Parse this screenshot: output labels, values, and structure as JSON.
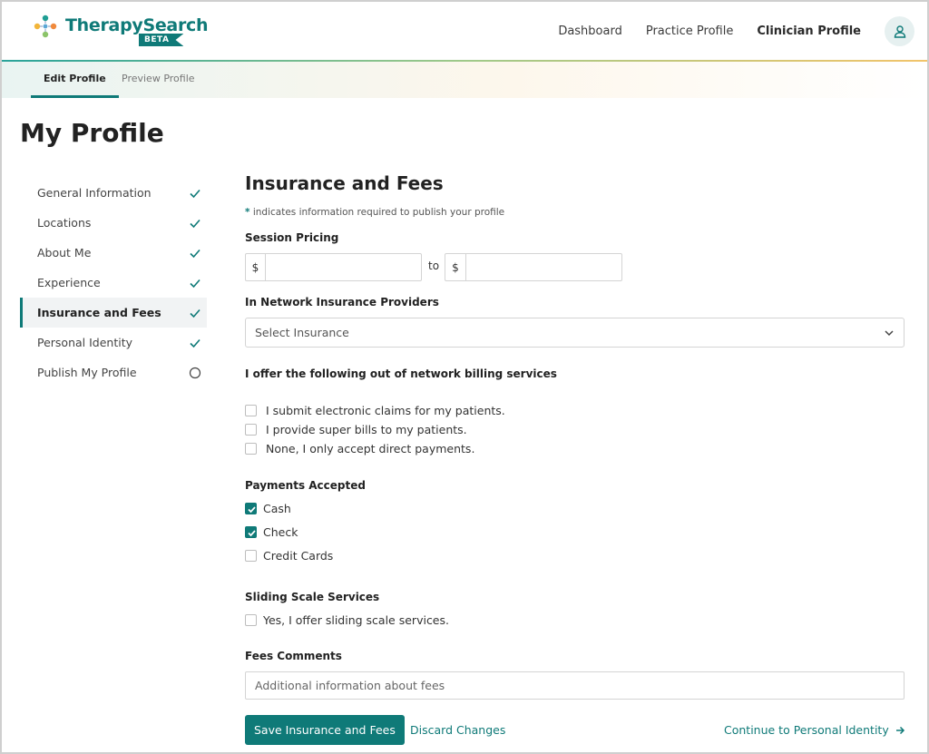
{
  "header": {
    "brand": "TherapySearch",
    "badge": "BETA",
    "nav": [
      {
        "label": "Dashboard"
      },
      {
        "label": "Practice Profile"
      },
      {
        "label": "Clinician Profile"
      }
    ],
    "user_icon": "user-icon"
  },
  "subtabs": [
    {
      "label": "Edit Profile",
      "active": true
    },
    {
      "label": "Preview Profile",
      "active": false
    }
  ],
  "page": {
    "title": "My Profile"
  },
  "sidebar": {
    "items": [
      {
        "label": "General Information",
        "status": "complete"
      },
      {
        "label": "Locations",
        "status": "complete"
      },
      {
        "label": "About Me",
        "status": "complete"
      },
      {
        "label": "Experience",
        "status": "complete"
      },
      {
        "label": "Insurance and Fees",
        "status": "complete",
        "active": true
      },
      {
        "label": "Personal Identity",
        "status": "complete"
      },
      {
        "label": "Publish My Profile",
        "status": "incomplete"
      }
    ]
  },
  "form": {
    "title": "Insurance and Fees",
    "required_marker": "*",
    "required_note": "indicates information required to publish your profile",
    "session_pricing": {
      "label": "Session Pricing",
      "currency": "$",
      "to_label": "to",
      "min_value": "",
      "max_value": ""
    },
    "insurance": {
      "label": "In Network Insurance Providers",
      "placeholder": "Select Insurance"
    },
    "billing": {
      "label": "I offer the following out of network billing services",
      "options": [
        {
          "label": "I submit electronic claims for my patients.",
          "checked": false
        },
        {
          "label": "I provide super bills to my patients.",
          "checked": false
        },
        {
          "label": "None, I only accept direct payments.",
          "checked": false
        }
      ]
    },
    "payments": {
      "label": "Payments Accepted",
      "options": [
        {
          "label": "Cash",
          "checked": true
        },
        {
          "label": "Check",
          "checked": true
        },
        {
          "label": "Credit Cards",
          "checked": false
        }
      ]
    },
    "sliding_scale": {
      "label": "Sliding Scale Services",
      "option": {
        "label": "Yes, I offer sliding scale services.",
        "checked": false
      }
    },
    "fees_comments": {
      "label": "Fees Comments",
      "placeholder": "Additional information about fees"
    },
    "actions": {
      "save": "Save Insurance and Fees",
      "discard": "Discard Changes",
      "continue": "Continue to Personal Identity"
    }
  },
  "colors": {
    "accent": "#0f7a78",
    "text": "#2a2a2a"
  }
}
